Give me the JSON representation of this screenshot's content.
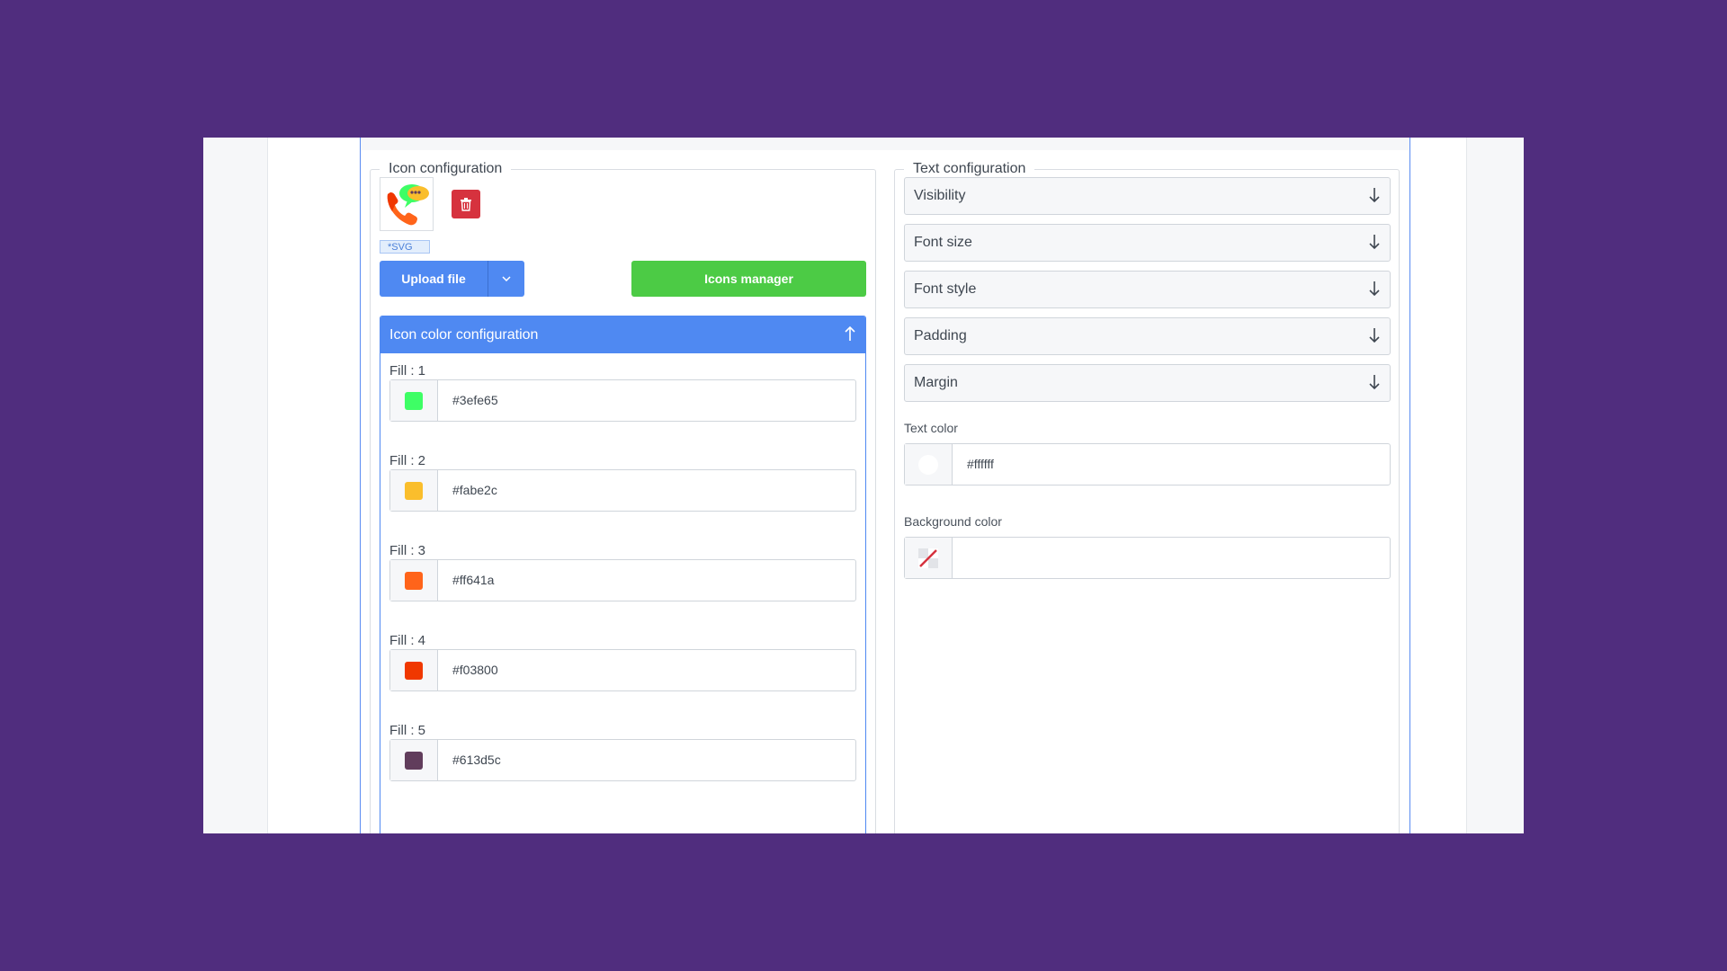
{
  "icon_config": {
    "legend": "Icon configuration",
    "badge": "*SVG",
    "upload_label": "Upload file",
    "icons_manager_label": "Icons manager",
    "accordion_title": "Icon color configuration",
    "fills": [
      {
        "label": "Fill : 1",
        "value": "#3efe65",
        "color": "#3efe65"
      },
      {
        "label": "Fill : 2",
        "value": "#fabe2c",
        "color": "#fabe2c"
      },
      {
        "label": "Fill : 3",
        "value": "#ff641a",
        "color": "#ff641a"
      },
      {
        "label": "Fill : 4",
        "value": "#f03800",
        "color": "#f03800"
      },
      {
        "label": "Fill : 5",
        "value": "#613d5c",
        "color": "#613d5c"
      }
    ]
  },
  "text_config": {
    "legend": "Text configuration",
    "dropdowns": [
      "Visibility",
      "Font size",
      "Font style",
      "Padding",
      "Margin"
    ],
    "text_color_label": "Text color",
    "text_color_value": "#ffffff",
    "background_color_label": "Background color",
    "background_color_value": ""
  },
  "colors": {
    "background": "#502d7e",
    "primary": "#4f89f2",
    "success": "#4ccb45",
    "danger": "#d6323e"
  }
}
